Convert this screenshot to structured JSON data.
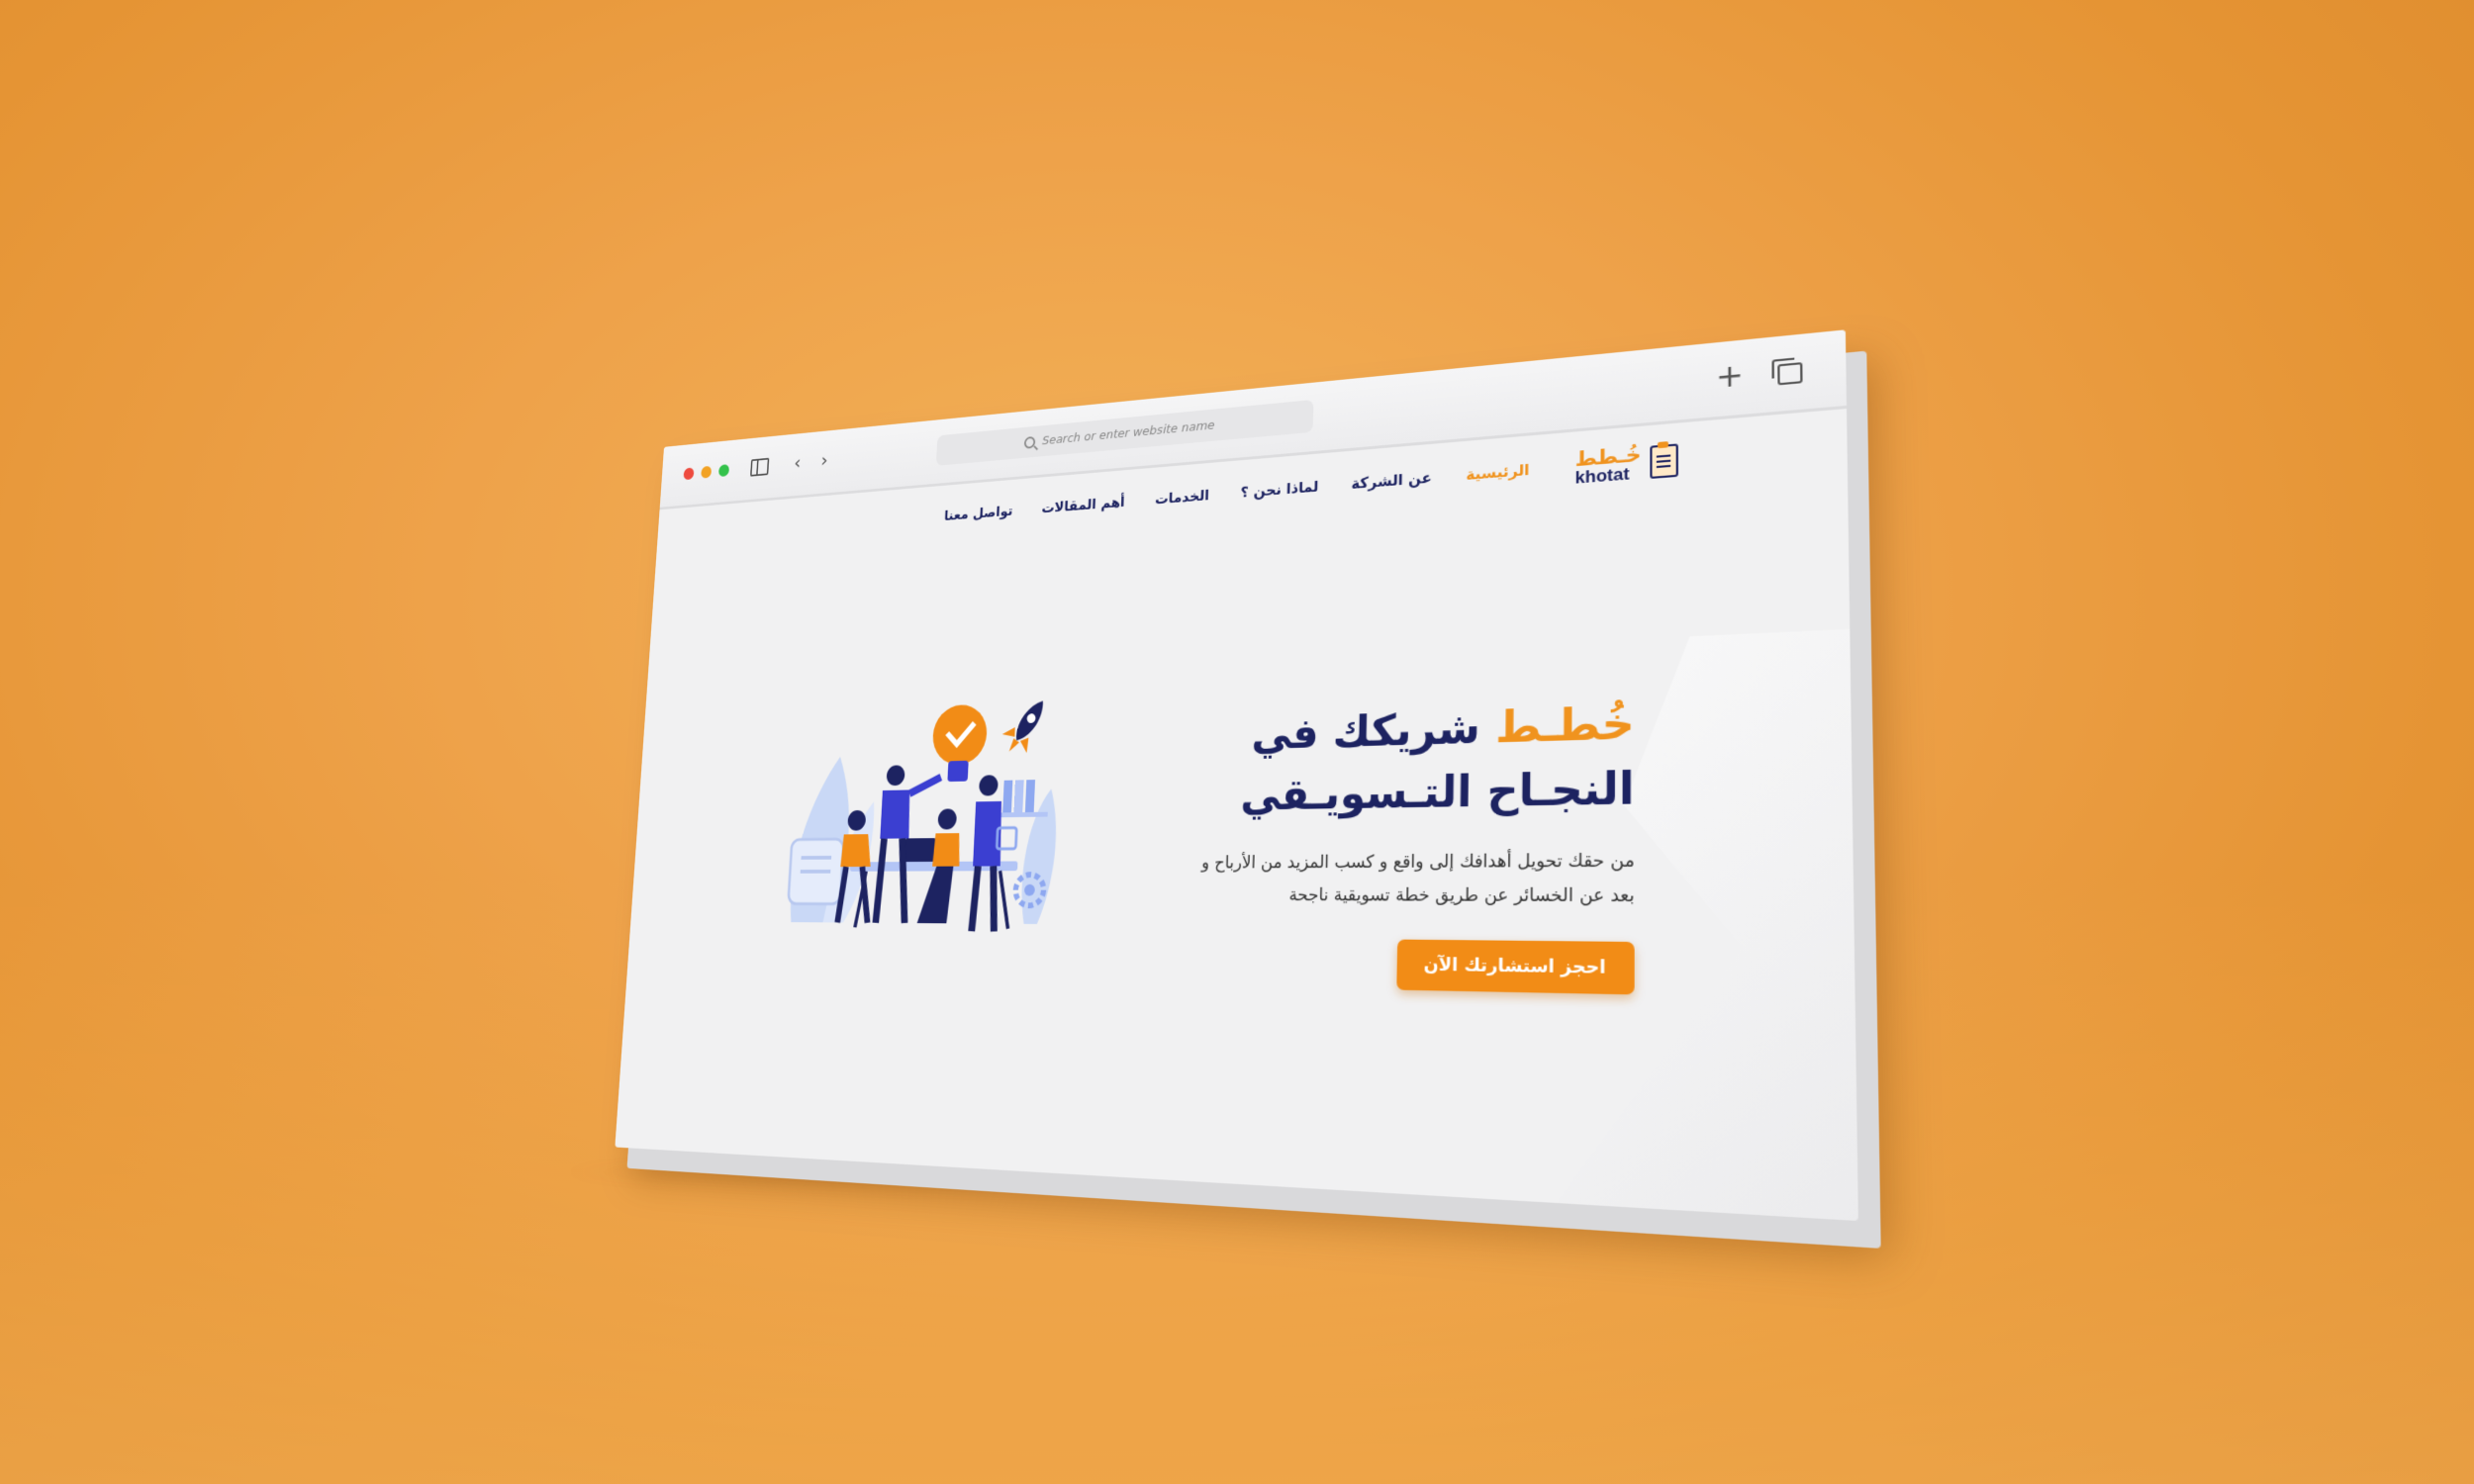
{
  "browser": {
    "url_placeholder": "Search or enter website name",
    "window_buttons": [
      "close",
      "minimize",
      "zoom"
    ],
    "icons": [
      "sidebar-icon",
      "back-icon",
      "forward-icon",
      "new-tab-icon",
      "tabs-overview-icon"
    ]
  },
  "site": {
    "logo": {
      "arabic": "خُـطط",
      "latin": "khotat"
    },
    "nav": [
      {
        "label": "الرئيسية",
        "active": true
      },
      {
        "label": "عن الشركة",
        "active": false
      },
      {
        "label": "لماذا نحن ؟",
        "active": false
      },
      {
        "label": "الخدمات",
        "active": false
      },
      {
        "label": "أهم المقالات",
        "active": false
      },
      {
        "label": "تواصل معنا",
        "active": false
      }
    ],
    "hero": {
      "title_brand": "خُطـط",
      "title_rest": " شريكك في",
      "title_line2": "النجـاح التـسويـقي",
      "description": "من حقك تحويل أهدافك إلى واقع و كسب المزيد من الأرباح و بعد عن الخسائر عن طريق خطة تسويقية ناجحة",
      "cta": "احجز استشارتك الآن"
    }
  },
  "colors": {
    "background": "#eea24a",
    "brand_orange": "#f0931e",
    "brand_navy": "#1d2361",
    "page_bg": "#f1f1f2"
  }
}
